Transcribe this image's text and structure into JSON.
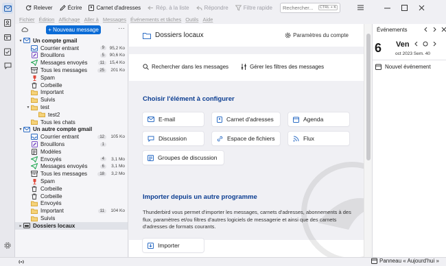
{
  "toolbar": {
    "get_messages": "Relever",
    "write": "Écrire",
    "address_book": "Carnet d'adresses",
    "reply_list": "Rép. à la liste",
    "reply": "Répondre",
    "quick_filter": "Filtre rapide",
    "search_placeholder": "Rechercher...",
    "search_shortcut": "CTRL + K"
  },
  "menubar": [
    "Fichier",
    "Édition",
    "Affichage",
    "Aller à",
    "Messages",
    "Événements et tâches",
    "Outils",
    "Aide"
  ],
  "folder_pane": {
    "new_message": "+ Nouveau message",
    "folders": [
      {
        "label": "Un compte gmail",
        "type": "account",
        "twisty": "v",
        "level": 0
      },
      {
        "label": "Courrier entrant",
        "icon": "inbox",
        "count": "9",
        "size": "95,2 Ko",
        "level": 1
      },
      {
        "label": "Brouillons",
        "icon": "drafts",
        "count": "5",
        "size": "90,6 Ko",
        "level": 1
      },
      {
        "label": "Messages envoyés",
        "icon": "sent",
        "count": "11",
        "size": "15,4 Ko",
        "level": 1
      },
      {
        "label": "Tous les messages",
        "icon": "archive",
        "count": "25",
        "size": "201 Ko",
        "level": 1
      },
      {
        "label": "Spam",
        "icon": "spam",
        "level": 1
      },
      {
        "label": "Corbeille",
        "icon": "trash",
        "level": 1
      },
      {
        "label": "Important",
        "icon": "folder",
        "level": 1
      },
      {
        "label": "Suivis",
        "icon": "folder",
        "level": 1
      },
      {
        "label": "test",
        "icon": "folder",
        "twisty": "v",
        "level": 1
      },
      {
        "label": "test2",
        "icon": "folder",
        "level": 2
      },
      {
        "label": "Tous les chats",
        "icon": "folder",
        "level": 1
      },
      {
        "label": "Un autre compte gmail",
        "type": "account",
        "twisty": "v",
        "level": 0
      },
      {
        "label": "Courrier entrant",
        "icon": "inbox",
        "count": "12",
        "size": "105 Ko",
        "level": 1
      },
      {
        "label": "Brouillons",
        "icon": "drafts",
        "count": "1",
        "level": 1
      },
      {
        "label": "Modèles",
        "icon": "templates",
        "level": 1
      },
      {
        "label": "Envoyés",
        "icon": "sent",
        "count": "4",
        "size": "3,1 Mo",
        "level": 1
      },
      {
        "label": "Messages envoyés",
        "icon": "sent",
        "count": "6",
        "size": "3,1 Mo",
        "level": 1
      },
      {
        "label": "Tous les messages",
        "icon": "archive",
        "count": "18",
        "size": "3,2 Mo",
        "level": 1
      },
      {
        "label": "Spam",
        "icon": "spam",
        "level": 1
      },
      {
        "label": "Corbeille",
        "icon": "trash",
        "level": 1
      },
      {
        "label": "Corbeille",
        "icon": "trash",
        "level": 1
      },
      {
        "label": "Envoyés",
        "icon": "folder",
        "level": 1
      },
      {
        "label": "Important",
        "icon": "folder",
        "count": "11",
        "size": "104 Ko",
        "level": 1
      },
      {
        "label": "Suivis",
        "icon": "folder",
        "level": 1
      },
      {
        "label": "Dossiers locaux",
        "type": "account",
        "twisty": ">",
        "level": 0,
        "selected": true
      }
    ]
  },
  "main": {
    "title": "Dossiers locaux",
    "account_settings": "Paramètres du compte",
    "search_messages": "Rechercher dans les messages",
    "manage_filters": "Gérer les filtres des messages",
    "setup_heading": "Choisir l'élément à configurer",
    "setup_items": [
      "E-mail",
      "Carnet d'adresses",
      "Agenda",
      "Discussion",
      "Espace de fichiers",
      "Flux",
      "Groupes de discussion"
    ],
    "import_heading": "Importer depuis un autre programme",
    "import_text": "Thunderbird vous permet d'importer les messages, carnets d'adresses, abonnements à des flux, paramètres et/ou filtres d'autres logiciels de messagerie et ainsi que des carnets d'adresses de formats courants.",
    "import_button": "Importer"
  },
  "today_pane": {
    "header": "Événements",
    "day": "6",
    "weekday": "Ven",
    "subline": "oct 2023   Sem. 40",
    "new_event": "Nouvel événement"
  },
  "status": {
    "today_pane_toggle": "Panneau « Aujourd'hui »"
  },
  "colors": {
    "accent": "#0a6bd6",
    "heading": "#0b3d91",
    "selected_row": "#e0e2e8"
  }
}
